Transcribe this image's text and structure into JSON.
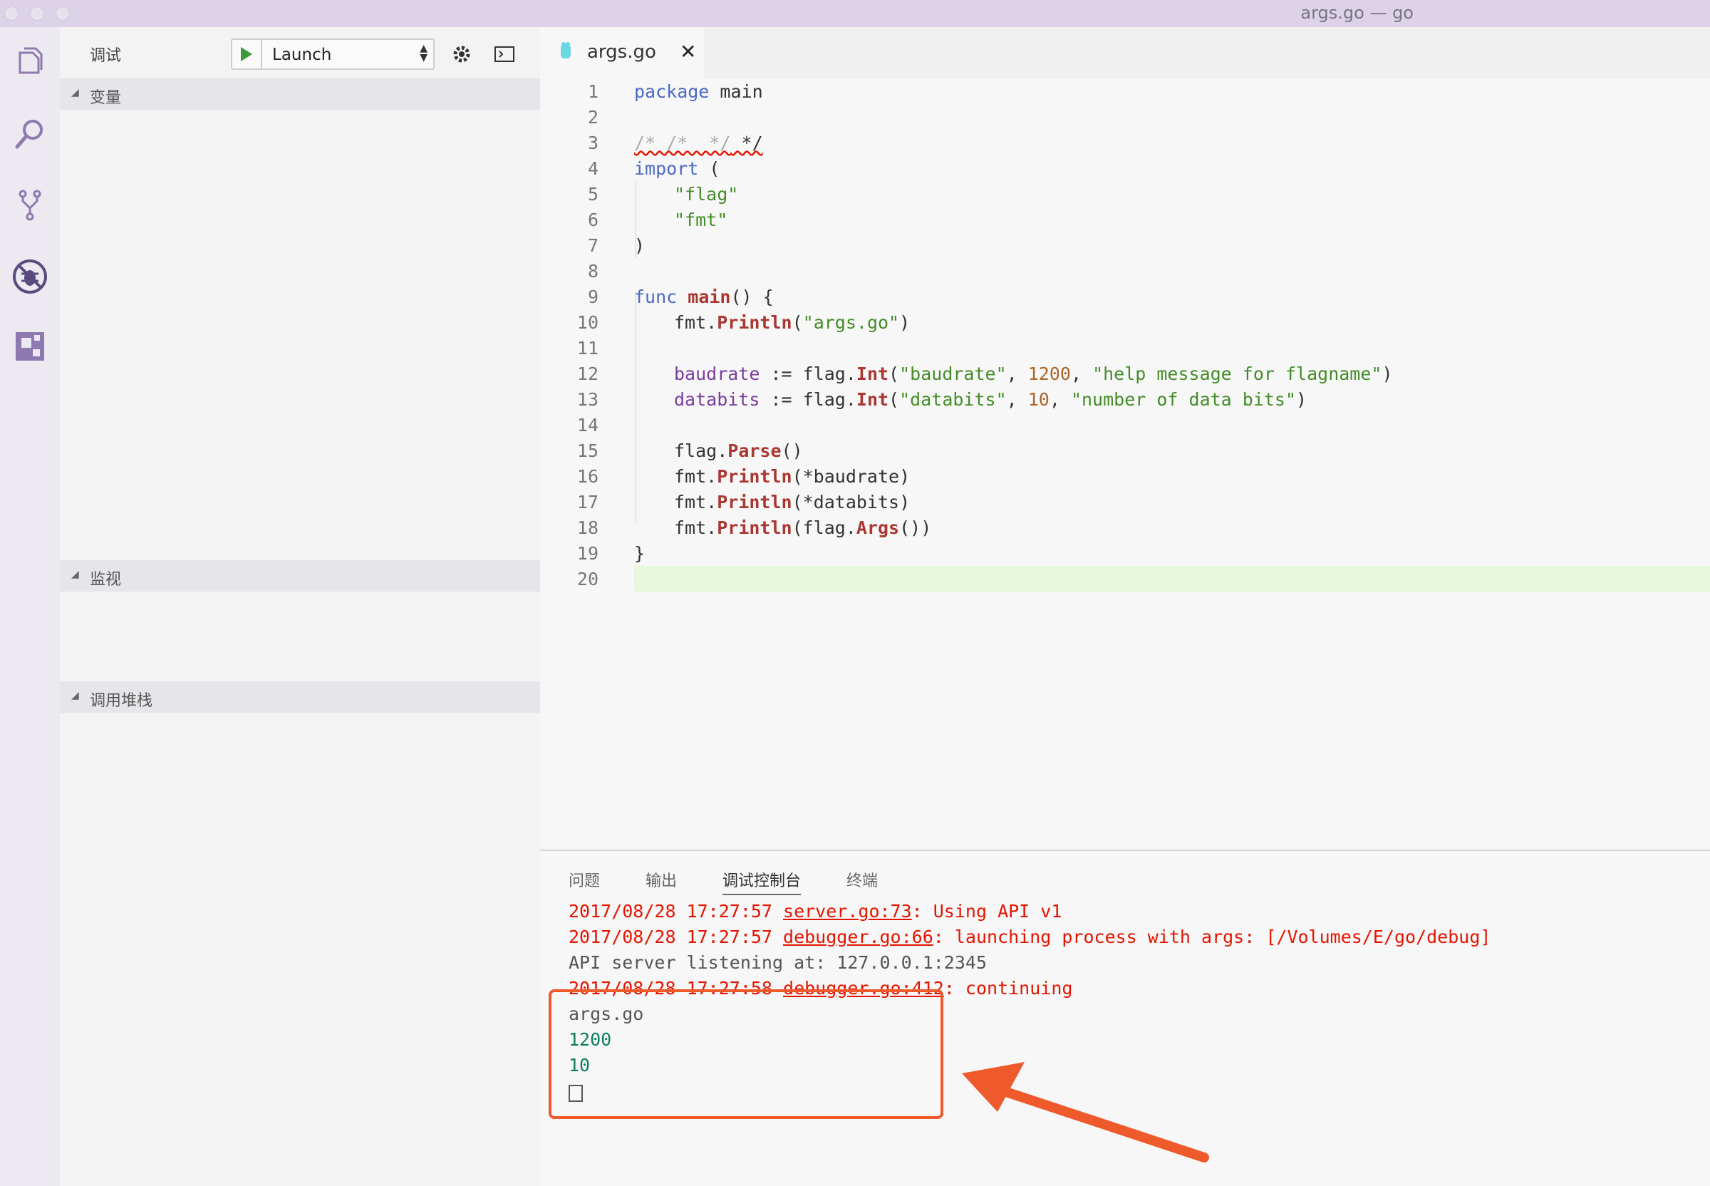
{
  "window": {
    "title": "args.go — go"
  },
  "sidebar": {
    "title": "调试",
    "config": "Launch",
    "sections": [
      {
        "label": "变量"
      },
      {
        "label": "监视"
      },
      {
        "label": "调用堆栈"
      }
    ]
  },
  "editor": {
    "tab": {
      "name": "args.go"
    },
    "lines": [
      {
        "n": "1"
      },
      {
        "n": "2"
      },
      {
        "n": "3"
      },
      {
        "n": "4"
      },
      {
        "n": "5"
      },
      {
        "n": "6"
      },
      {
        "n": "7"
      },
      {
        "n": "8"
      },
      {
        "n": "9"
      },
      {
        "n": "10"
      },
      {
        "n": "11"
      },
      {
        "n": "12"
      },
      {
        "n": "13"
      },
      {
        "n": "14"
      },
      {
        "n": "15"
      },
      {
        "n": "16"
      },
      {
        "n": "17"
      },
      {
        "n": "18"
      },
      {
        "n": "19"
      },
      {
        "n": "20"
      }
    ],
    "code": {
      "l1_kw": "package",
      "l1_rest": " main",
      "l3_comment": "/* /*  */",
      "l3_rest": " */",
      "l4_kw": "import",
      "l4_rest": " (",
      "l5": "\"flag\"",
      "l6": "\"fmt\"",
      "l7": ")",
      "l9_kw": "func",
      "l9_fn": "main",
      "l9_rest": "() {",
      "l10_a": "fmt.",
      "l10_fn": "Println",
      "l10_b": "(",
      "l10_s": "\"args.go\"",
      "l10_c": ")",
      "l12_v": "baudrate",
      "l12_a": " := flag.",
      "l12_fn": "Int",
      "l12_b": "(",
      "l12_s1": "\"baudrate\"",
      "l12_c": ", ",
      "l12_n": "1200",
      "l12_d": ", ",
      "l12_s2": "\"help message for flagname\"",
      "l12_e": ")",
      "l13_v": "databits",
      "l13_a": " := flag.",
      "l13_fn": "Int",
      "l13_b": "(",
      "l13_s1": "\"databits\"",
      "l13_c": ", ",
      "l13_n": "10",
      "l13_d": ", ",
      "l13_s2": "\"number of data bits\"",
      "l13_e": ")",
      "l15_a": "flag.",
      "l15_fn": "Parse",
      "l15_b": "()",
      "l16_a": "fmt.",
      "l16_fn": "Println",
      "l16_b": "(*baudrate)",
      "l17_a": "fmt.",
      "l17_fn": "Println",
      "l17_b": "(*databits)",
      "l18_a": "fmt.",
      "l18_fn": "Println",
      "l18_b": "(flag.",
      "l18_fn2": "Args",
      "l18_c": "())",
      "l19": "}"
    }
  },
  "panel": {
    "tabs": [
      "问题",
      "输出",
      "调试控制台",
      "终端"
    ],
    "active_tab": "调试控制台",
    "console": {
      "l1_ts": "2017/08/28 17:27:57 ",
      "l1_src": "server.go:73",
      "l1_msg": ": Using API v1",
      "l2_ts": "2017/08/28 17:27:57 ",
      "l2_src": "debugger.go:66",
      "l2_msg": ": launching process with args: [/Volumes/E/go/debug]",
      "l3": "API server listening at: 127.0.0.1:2345",
      "l4_ts": "2017/08/28 17:27:58 ",
      "l4_src": "debugger.go:412",
      "l4_msg": ": continuing",
      "l5": "args.go",
      "l6": "1200",
      "l7": "10"
    }
  },
  "colors": {
    "accent_annotation": "#ef5a2c",
    "titlebar": "#dcd3e9",
    "activity_icon": "#8e79b0"
  },
  "icons": [
    "files-icon",
    "search-icon",
    "source-control-icon",
    "debug-icon",
    "extensions-icon",
    "play-icon",
    "gear-icon",
    "terminal-icon",
    "go-file-icon",
    "close-icon"
  ]
}
